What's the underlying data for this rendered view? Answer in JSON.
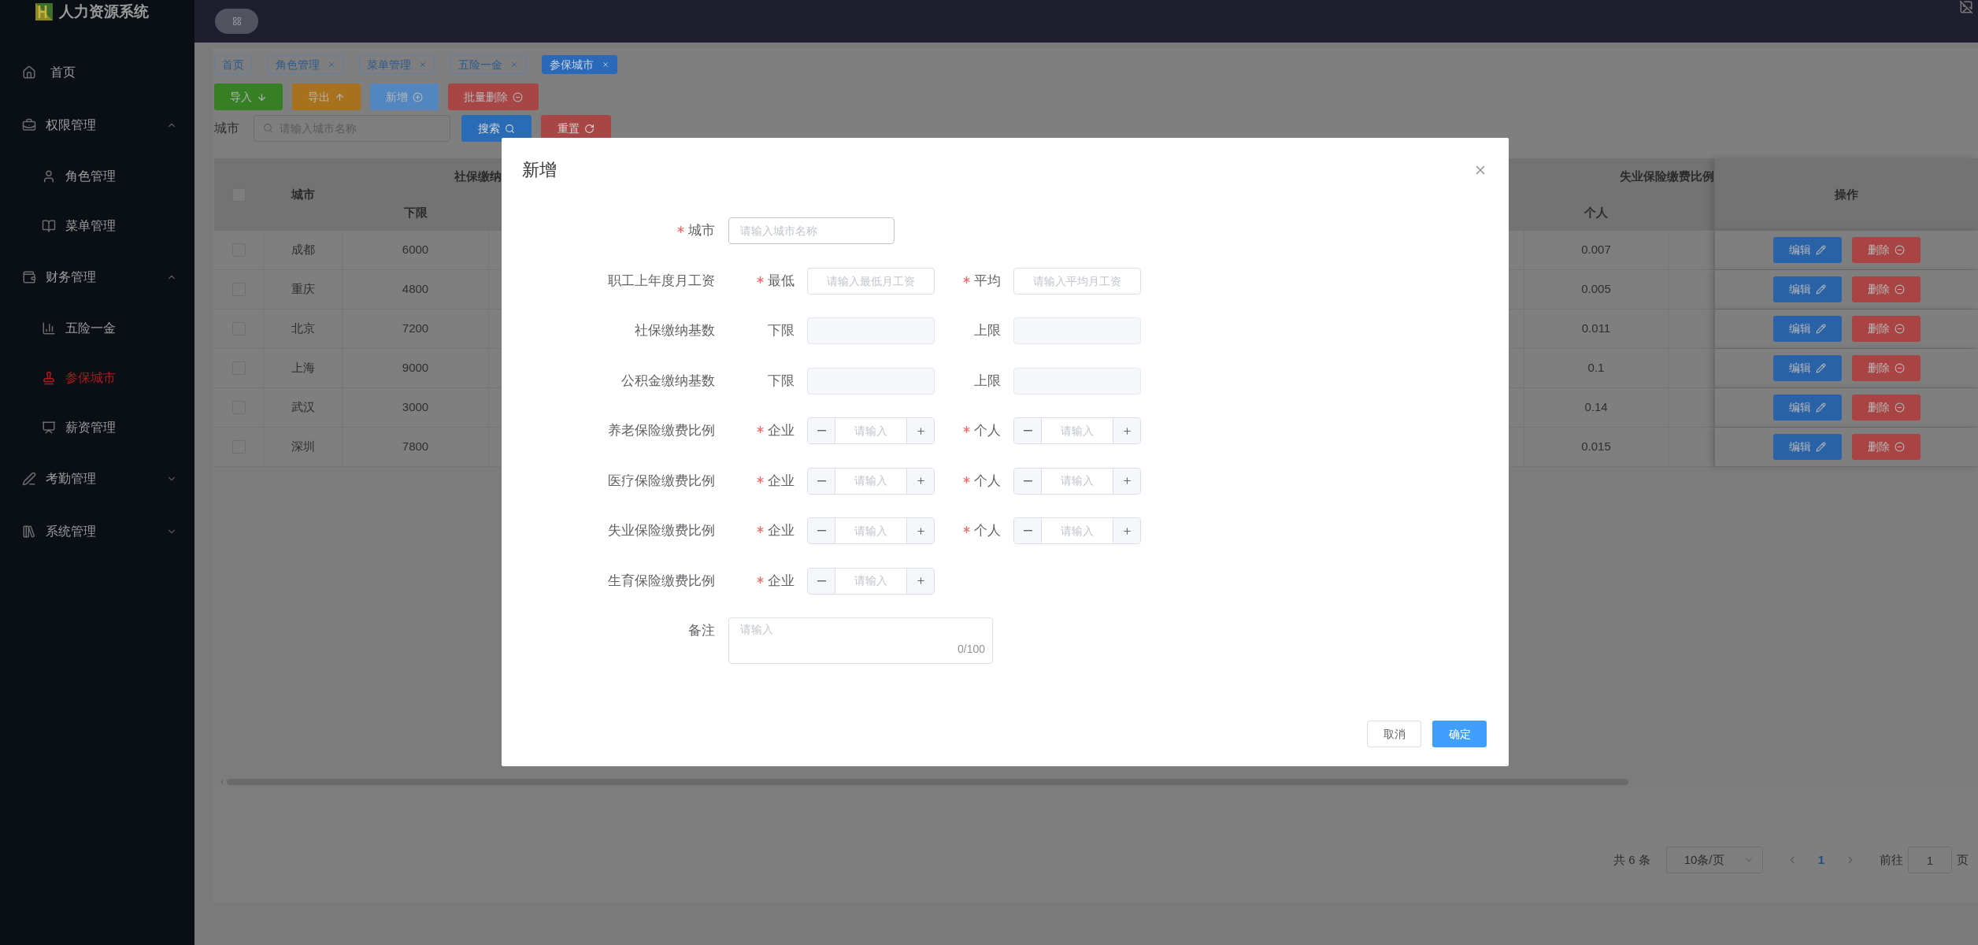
{
  "sidebar": {
    "title": "人力资源系统",
    "items": [
      {
        "label": "首页",
        "selected": false
      },
      {
        "label": "权限管理",
        "expanded": true,
        "children": [
          {
            "label": "角色管理",
            "selected": false
          },
          {
            "label": "菜单管理",
            "selected": false
          }
        ]
      },
      {
        "label": "财务管理",
        "expanded": true,
        "children": [
          {
            "label": "五险一金",
            "selected": false
          },
          {
            "label": "参保城市",
            "selected": true
          },
          {
            "label": "薪资管理",
            "selected": false
          }
        ]
      },
      {
        "label": "考勤管理",
        "expanded": false
      },
      {
        "label": "系统管理",
        "expanded": false
      }
    ]
  },
  "tags": [
    {
      "label": "首页",
      "selected": false,
      "closable": false
    },
    {
      "label": "角色管理",
      "selected": false,
      "closable": true
    },
    {
      "label": "菜单管理",
      "selected": false,
      "closable": true
    },
    {
      "label": "五险一金",
      "selected": false,
      "closable": true
    },
    {
      "label": "参保城市",
      "selected": true,
      "closable": true
    }
  ],
  "toolbar": [
    {
      "label": "导入",
      "kind": "import"
    },
    {
      "label": "导出",
      "kind": "export"
    },
    {
      "label": "新增",
      "kind": "add"
    },
    {
      "label": "批量删除",
      "kind": "delete"
    }
  ],
  "search": {
    "label": "城市",
    "placeholder": "请输入城市名称",
    "buttons": [
      {
        "label": "搜索",
        "kind": "search"
      },
      {
        "label": "重置",
        "kind": "reset"
      }
    ]
  },
  "table": {
    "header_checked": false,
    "left_columns": {
      "city": "城市",
      "group": "社保缴纳",
      "lower": "下限"
    },
    "right_columns": {
      "group": "失业保险缴费比例",
      "personal": "个人",
      "actions": "操作"
    },
    "rows": [
      {
        "checked": false,
        "city": "成都",
        "lower": "6000",
        "personal": "0.007",
        "actions": [
          {
            "label": "编辑",
            "kind": "edit"
          },
          {
            "label": "删除",
            "kind": "delete"
          }
        ]
      },
      {
        "checked": false,
        "city": "重庆",
        "lower": "4800",
        "personal": "0.005",
        "actions": [
          {
            "label": "编辑",
            "kind": "edit"
          },
          {
            "label": "删除",
            "kind": "delete"
          }
        ]
      },
      {
        "checked": false,
        "city": "北京",
        "lower": "7200",
        "personal": "0.011",
        "actions": [
          {
            "label": "编辑",
            "kind": "edit"
          },
          {
            "label": "删除",
            "kind": "delete"
          }
        ]
      },
      {
        "checked": false,
        "city": "上海",
        "lower": "9000",
        "personal": "0.1",
        "actions": [
          {
            "label": "编辑",
            "kind": "edit"
          },
          {
            "label": "删除",
            "kind": "delete"
          }
        ]
      },
      {
        "checked": false,
        "city": "武汉",
        "lower": "3000",
        "personal": "0.14",
        "actions": [
          {
            "label": "编辑",
            "kind": "edit"
          },
          {
            "label": "删除",
            "kind": "delete"
          }
        ]
      },
      {
        "checked": false,
        "city": "深圳",
        "lower": "7800",
        "personal": "0.015",
        "actions": [
          {
            "label": "编辑",
            "kind": "edit"
          },
          {
            "label": "删除",
            "kind": "delete"
          }
        ]
      }
    ]
  },
  "pagination": {
    "total": "共 6 条",
    "page_size": "10条/页",
    "pages": [
      {
        "label": "1",
        "selected": true
      }
    ],
    "goto_label": "前往",
    "goto_value": "1",
    "goto_suffix": "页"
  },
  "dialog": {
    "title": "新增",
    "rows": [
      {
        "kind": "single",
        "label": "城市",
        "required": true,
        "placeholder": "请输入城市名称"
      },
      {
        "kind": "pair",
        "label": "职工上年度月工资",
        "fields": [
          {
            "label": "最低",
            "required": true,
            "kind": "input",
            "placeholder": "请输入最低月工资"
          },
          {
            "label": "平均",
            "required": true,
            "kind": "input",
            "placeholder": "请输入平均月工资"
          }
        ]
      },
      {
        "kind": "pair",
        "label": "社保缴纳基数",
        "fields": [
          {
            "label": "下限",
            "required": false,
            "kind": "disabled"
          },
          {
            "label": "上限",
            "required": false,
            "kind": "disabled"
          }
        ]
      },
      {
        "kind": "pair",
        "label": "公积金缴纳基数",
        "fields": [
          {
            "label": "下限",
            "required": false,
            "kind": "disabled"
          },
          {
            "label": "上限",
            "required": false,
            "kind": "disabled"
          }
        ]
      },
      {
        "kind": "pair",
        "label": "养老保险缴费比例",
        "fields": [
          {
            "label": "企业",
            "required": true,
            "kind": "stepper",
            "placeholder": "请输入"
          },
          {
            "label": "个人",
            "required": true,
            "kind": "stepper",
            "placeholder": "请输入"
          }
        ]
      },
      {
        "kind": "pair",
        "label": "医疗保险缴费比例",
        "fields": [
          {
            "label": "企业",
            "required": true,
            "kind": "stepper",
            "placeholder": "请输入"
          },
          {
            "label": "个人",
            "required": true,
            "kind": "stepper",
            "placeholder": "请输入"
          }
        ]
      },
      {
        "kind": "pair",
        "label": "失业保险缴费比例",
        "fields": [
          {
            "label": "企业",
            "required": true,
            "kind": "stepper",
            "placeholder": "请输入"
          },
          {
            "label": "个人",
            "required": true,
            "kind": "stepper",
            "placeholder": "请输入"
          }
        ]
      },
      {
        "kind": "pair",
        "label": "生育保险缴费比例",
        "fields": [
          {
            "label": "企业",
            "required": true,
            "kind": "stepper",
            "placeholder": "请输入"
          }
        ]
      },
      {
        "kind": "textarea",
        "label": "备注",
        "required": false,
        "placeholder": "请输入",
        "counter": "0/100"
      }
    ],
    "buttons": [
      {
        "label": "取消",
        "kind": "cancel"
      },
      {
        "label": "确定",
        "kind": "primary"
      }
    ]
  }
}
